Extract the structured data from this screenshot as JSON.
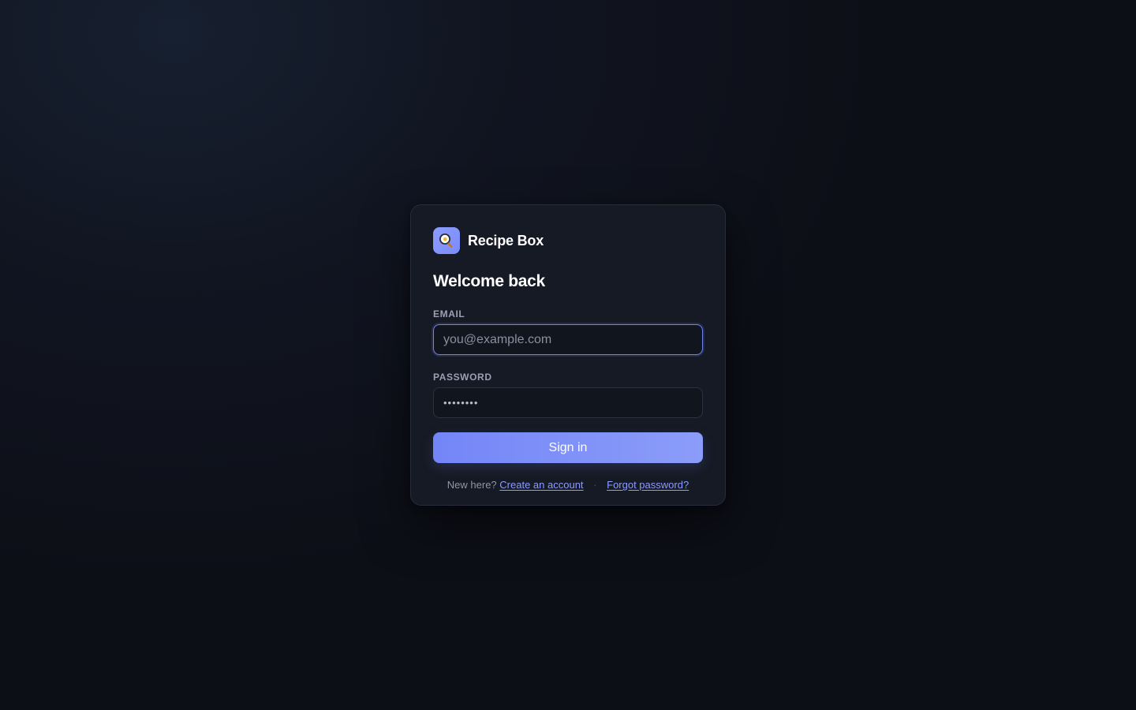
{
  "brand": {
    "name": "Recipe Box",
    "logo_icon": "frying-pan-egg-icon",
    "logo_color": "#8c9cff"
  },
  "form": {
    "heading": "Welcome back",
    "email": {
      "label": "Email",
      "placeholder": "you@example.com",
      "value": ""
    },
    "password": {
      "label": "Password",
      "value": "••••••••"
    },
    "submit_label": "Sign in"
  },
  "footer": {
    "prompt": "New here?",
    "create_account": "Create an account",
    "separator": "·",
    "forgot_password": "Forgot password?"
  },
  "colors": {
    "accent": "#7486f7",
    "link": "#8e9bff",
    "card_background": "#151a24"
  }
}
